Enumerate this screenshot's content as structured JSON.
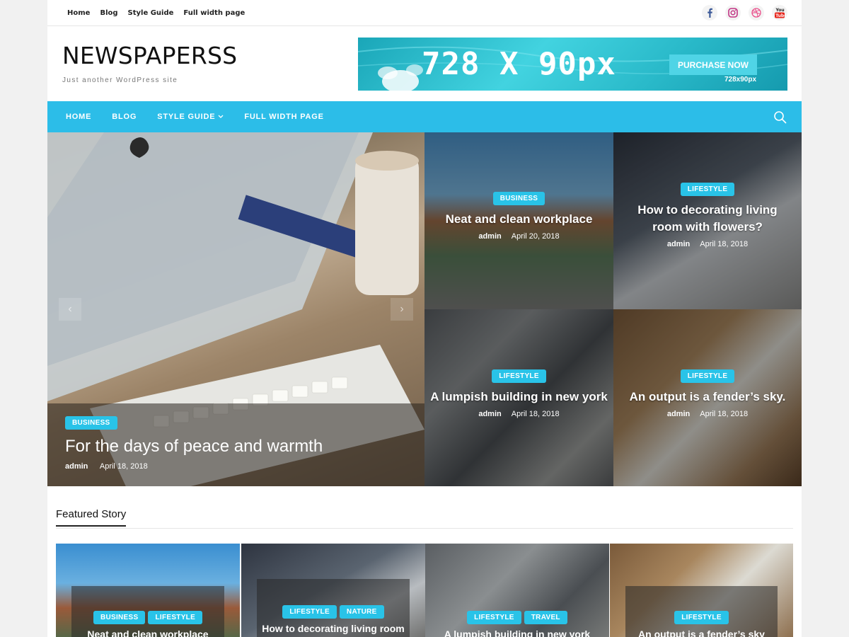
{
  "topnav": [
    "Home",
    "Blog",
    "Style Guide",
    "Full width page"
  ],
  "social": [
    "facebook-icon",
    "instagram-icon",
    "dribbble-icon",
    "youtube-icon"
  ],
  "site": {
    "title": "NEWSPAPERSS",
    "tagline": "Just another WordPress site"
  },
  "ad": {
    "headline": "728 X 90px",
    "button": "PURCHASE NOW",
    "size": "728x90px"
  },
  "mainnav": {
    "items": [
      "HOME",
      "BLOG",
      "STYLE GUIDE",
      "FULL WIDTH PAGE"
    ]
  },
  "hero": {
    "main": {
      "category": "BUSINESS",
      "title": "For the days of peace and warmth",
      "author": "admin",
      "date": "April 18, 2018"
    },
    "tiles": [
      {
        "category": "BUSINESS",
        "title": "Neat and clean workplace",
        "author": "admin",
        "date": "April 20, 2018"
      },
      {
        "category": "LIFESTYLE",
        "title": "How to decorating living room with flowers?",
        "author": "admin",
        "date": "April 18, 2018"
      },
      {
        "category": "LIFESTYLE",
        "title": "A lumpish building in new york",
        "author": "admin",
        "date": "April 18, 2018"
      },
      {
        "category": "LIFESTYLE",
        "title": "An output is a fender’s sky.",
        "author": "admin",
        "date": "April 18, 2018"
      }
    ]
  },
  "featured": {
    "heading": "Featured Story",
    "cards": [
      {
        "categories": [
          "BUSINESS",
          "LIFESTYLE"
        ],
        "title": "Neat and clean workplace"
      },
      {
        "categories": [
          "LIFESTYLE",
          "NATURE"
        ],
        "title": "How to decorating living room"
      },
      {
        "categories": [
          "LIFESTYLE",
          "TRAVEL"
        ],
        "title": "A lumpish building in new york"
      },
      {
        "categories": [
          "LIFESTYLE"
        ],
        "title": "An output is a fender’s sky"
      }
    ]
  },
  "colors": {
    "accent": "#2cbde8",
    "badge": "#29c3e8"
  }
}
